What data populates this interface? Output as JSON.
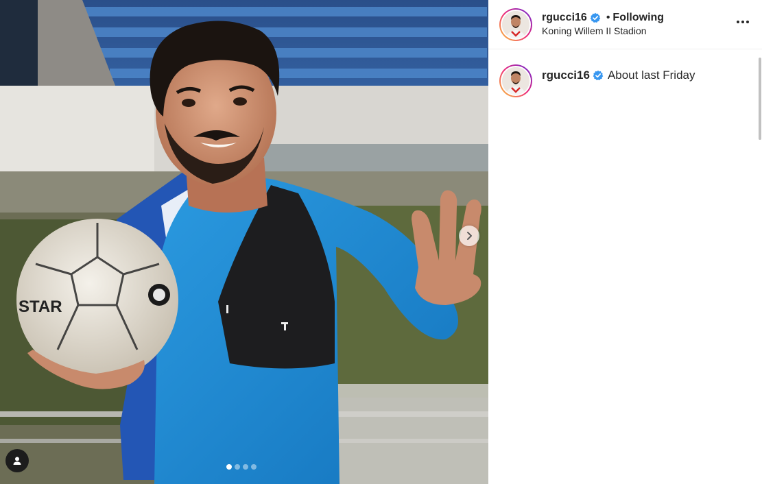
{
  "post": {
    "username": "rgucci16",
    "separator": "•",
    "following_label": "Following",
    "location": "Koning Willem II Stadion",
    "caption": "About last Friday",
    "media": {
      "slide_count": 4,
      "active_slide": 1
    }
  },
  "icons": {
    "verified": "verified-badge-icon",
    "more": "more-options-icon",
    "next": "chevron-right-icon",
    "tag": "user-tag-icon"
  },
  "colors": {
    "verified_blue": "#3897f0",
    "text": "#262626",
    "jersey_blue": "#1e8fd6"
  }
}
